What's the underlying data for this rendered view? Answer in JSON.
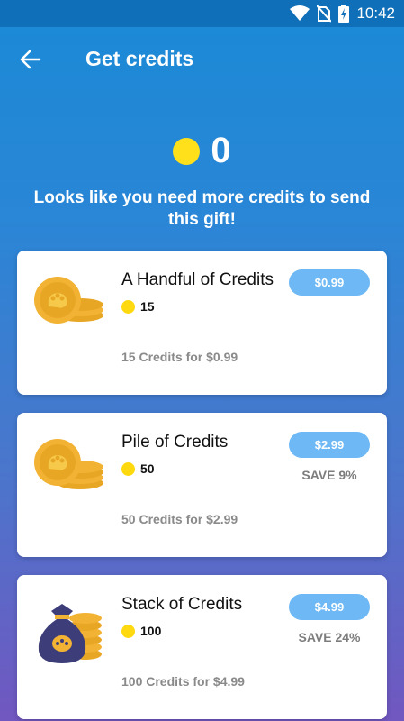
{
  "status_bar": {
    "time": "10:42"
  },
  "header": {
    "title": "Get credits"
  },
  "balance": {
    "value": "0"
  },
  "message": "Looks like you need more credits to send this gift!",
  "packages": [
    {
      "name": "A Handful of Credits",
      "credits": "15",
      "price": "$0.99",
      "save": "",
      "description": "15 Credits for $0.99",
      "icon": "coins-icon"
    },
    {
      "name": "Pile of Credits",
      "credits": "50",
      "price": "$2.99",
      "save": "SAVE 9%",
      "description": "50 Credits for $2.99",
      "icon": "coins-icon"
    },
    {
      "name": "Stack of Credits",
      "credits": "100",
      "price": "$4.99",
      "save": "SAVE 24%",
      "description": "100 Credits for $4.99",
      "icon": "money-bag-icon"
    }
  ],
  "colors": {
    "accent": "#6db8f5",
    "coin": "#ffe01a",
    "coin_gold": "#f2b233"
  }
}
